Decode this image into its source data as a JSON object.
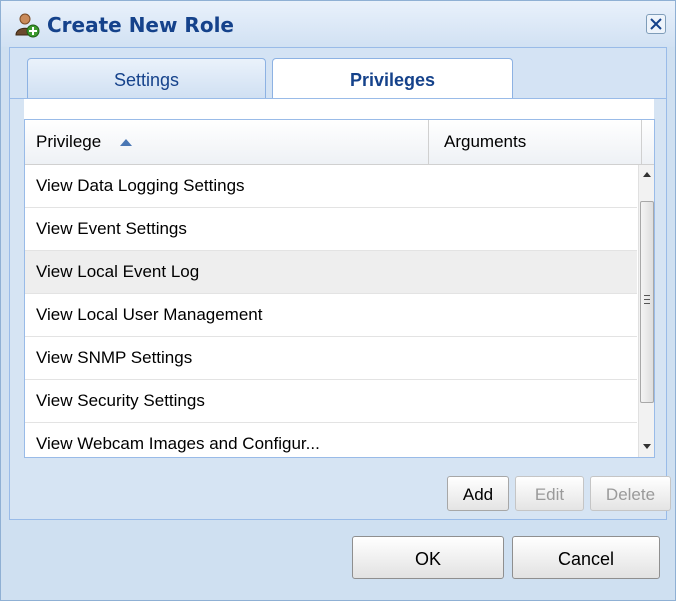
{
  "window": {
    "title": "Create New Role",
    "icon": "user-add-icon"
  },
  "tabs": [
    {
      "label": "Settings",
      "active": false
    },
    {
      "label": "Privileges",
      "active": true
    }
  ],
  "grid": {
    "columns": [
      {
        "label": "Privilege",
        "sort": "ascending"
      },
      {
        "label": "Arguments"
      }
    ],
    "rows": [
      {
        "privilege": "View Data Logging Settings",
        "arguments": ""
      },
      {
        "privilege": "View Event Settings",
        "arguments": ""
      },
      {
        "privilege": "View Local Event Log",
        "arguments": ""
      },
      {
        "privilege": "View Local User Management",
        "arguments": ""
      },
      {
        "privilege": "View SNMP Settings",
        "arguments": ""
      },
      {
        "privilege": "View Security Settings",
        "arguments": ""
      },
      {
        "privilege": "View Webcam Images and Configur...",
        "arguments": ""
      }
    ]
  },
  "grid_buttons": {
    "add": "Add",
    "edit": "Edit",
    "delete": "Delete"
  },
  "footer": {
    "ok": "OK",
    "cancel": "Cancel"
  },
  "colors": {
    "title_text": "#15428b",
    "panel_bg": "#d6e4f3",
    "border": "#99bbe8"
  }
}
